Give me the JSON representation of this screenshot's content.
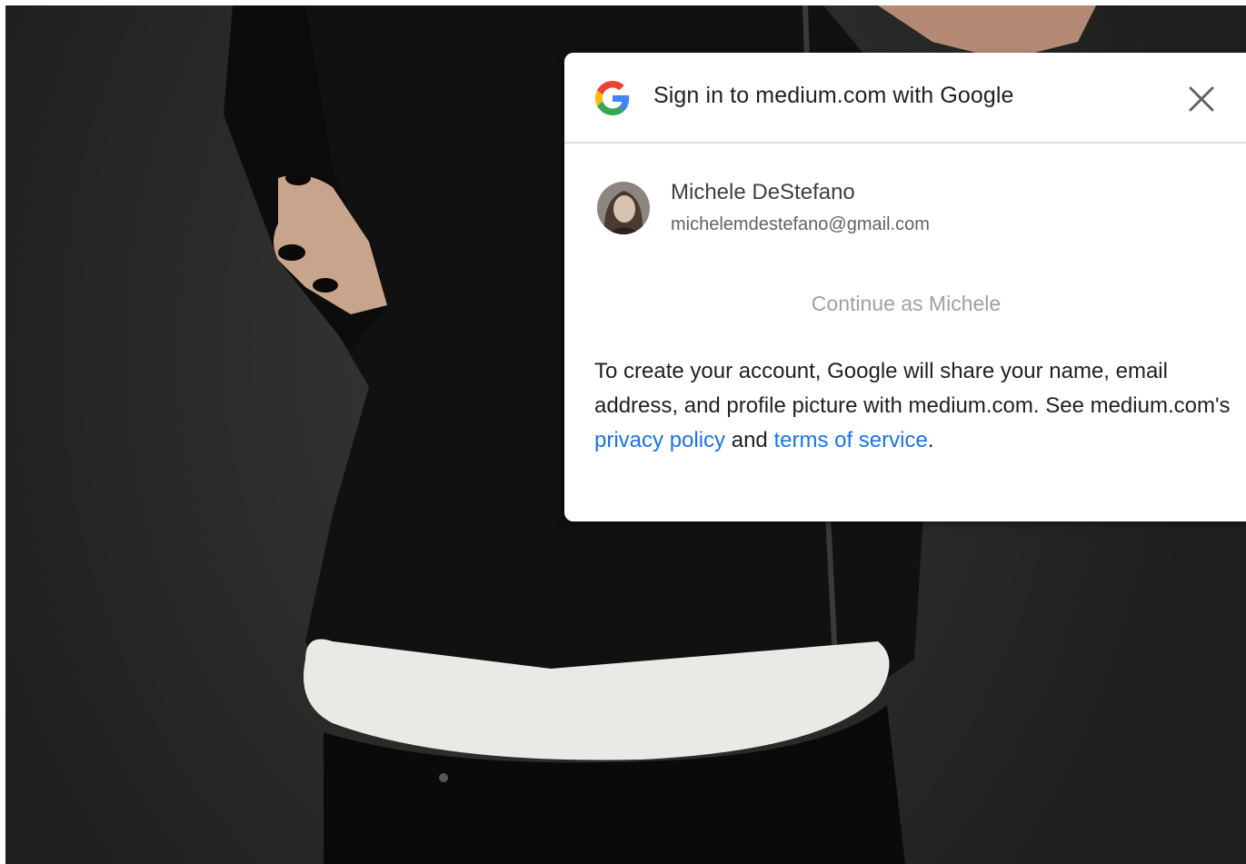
{
  "dialog": {
    "title": "Sign in to medium.com with Google",
    "account": {
      "name": "Michele DeStefano",
      "email": "michelemdestefano@gmail.com"
    },
    "continue_label": "Continue as Michele",
    "disclaimer": {
      "text_before": "To create your account, Google will share your name, email address, and profile picture with medium.com. See medium.com's ",
      "privacy_link": "privacy policy",
      "text_middle": " and ",
      "terms_link": "terms of service",
      "text_after": "."
    }
  },
  "colors": {
    "link": "#1a73e8",
    "continue_text": "#9aa0a6",
    "divider": "#dadce0",
    "backdrop": "#2b2b29"
  },
  "icons": {
    "logo": "google-g-icon",
    "close": "close-icon"
  }
}
